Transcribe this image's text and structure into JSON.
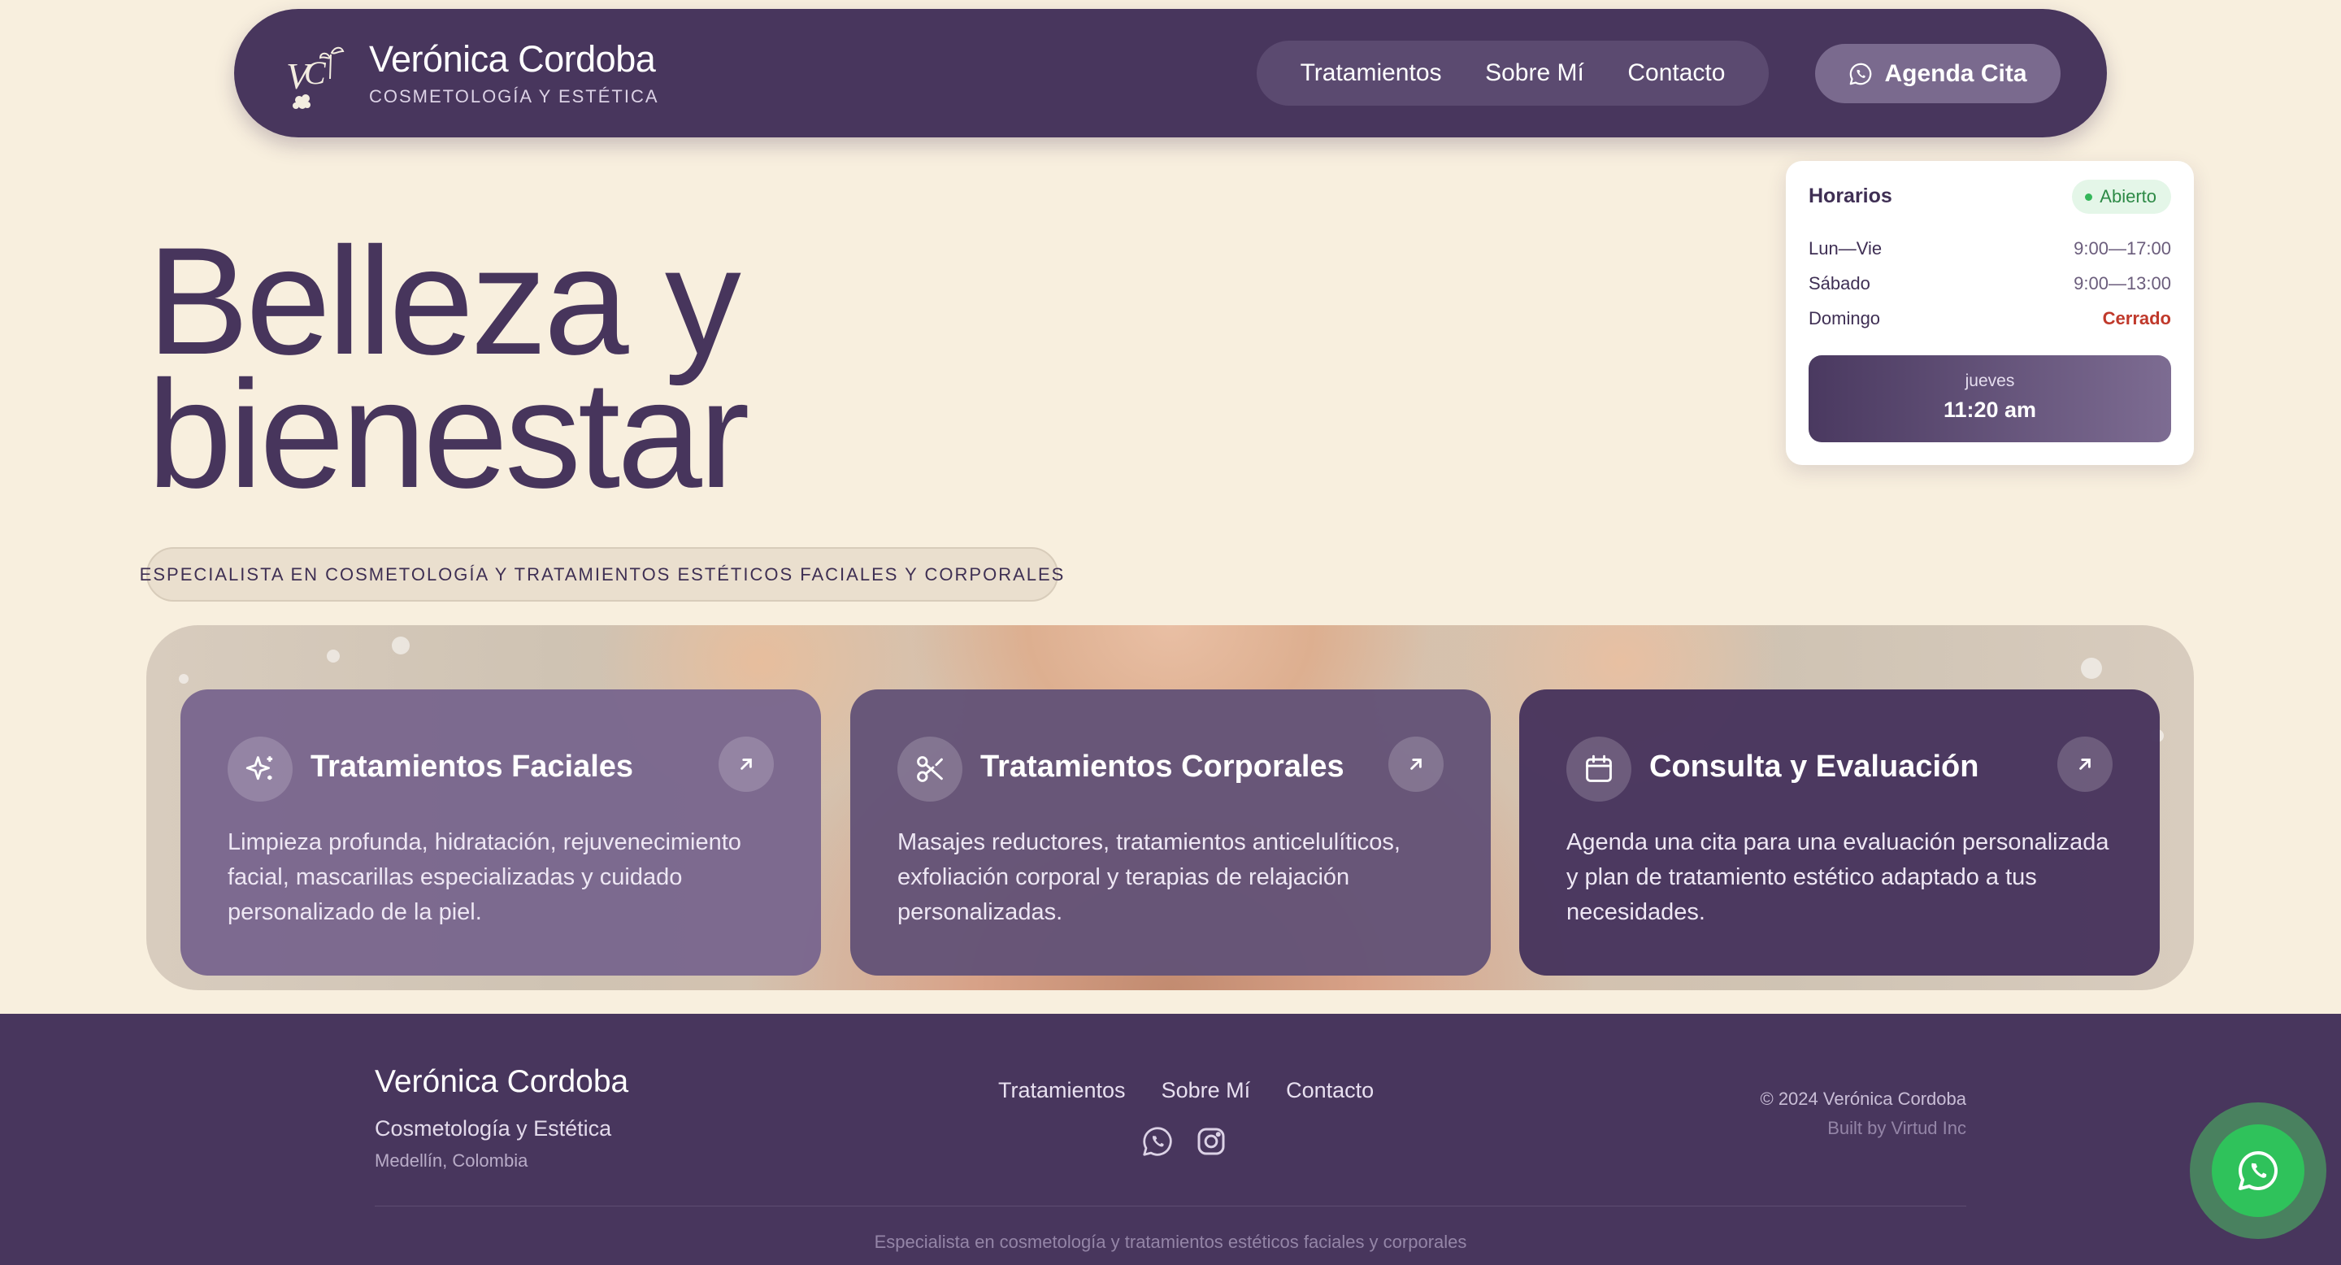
{
  "header": {
    "brand_name": "Verónica Cordoba",
    "brand_sub": "COSMETOLOGÍA Y ESTÉTICA",
    "nav": [
      "Tratamientos",
      "Sobre Mí",
      "Contacto"
    ],
    "cta_label": "Agenda Cita"
  },
  "hours": {
    "title": "Horarios",
    "status": "Abierto",
    "rows": [
      {
        "day": "Lun—Vie",
        "time": "9:00—17:00"
      },
      {
        "day": "Sábado",
        "time": "9:00—13:00"
      },
      {
        "day": "Domingo",
        "time": "Cerrado"
      }
    ],
    "today": "jueves",
    "now": "11:20 am"
  },
  "hero": {
    "title_line1": "Belleza y",
    "title_line2": "bienestar",
    "tagline": "ESPECIALISTA EN COSMETOLOGÍA Y TRATAMIENTOS ESTÉTICOS FACIALES Y CORPORALES"
  },
  "services": [
    {
      "icon": "sparkles-icon",
      "title": "Tratamientos Faciales",
      "description": "Limpieza profunda, hidratación, rejuvenecimiento facial, mascarillas especializadas y cuidado personalizado de la piel."
    },
    {
      "icon": "scissors-icon",
      "title": "Tratamientos Corporales",
      "description": "Masajes reductores, tratamientos anticelulíticos, exfoliación corporal y terapias de relajación personalizadas."
    },
    {
      "icon": "calendar-icon",
      "title": "Consulta y Evaluación",
      "description": "Agenda una cita para una evaluación personalizada y plan de tratamiento estético adaptado a tus necesidades."
    }
  ],
  "footer": {
    "name": "Verónica Cordoba",
    "subtitle": "Cosmetología y Estética",
    "city": "Medellín, Colombia",
    "nav": [
      "Tratamientos",
      "Sobre Mí",
      "Contacto"
    ],
    "social": [
      "whatsapp-icon",
      "instagram-icon"
    ],
    "copyright": "© 2024 Verónica Cordoba",
    "built_by": "Built by Virtud Inc",
    "tagline": "Especialista en cosmetología y tratamientos estéticos faciales y corporales"
  },
  "colors": {
    "background": "#F8EFDE",
    "primary": "#48365D",
    "accent": "#7A6A8E",
    "whatsapp": "#2FC25B",
    "open": "#2D8A46",
    "closed": "#C0392B"
  }
}
